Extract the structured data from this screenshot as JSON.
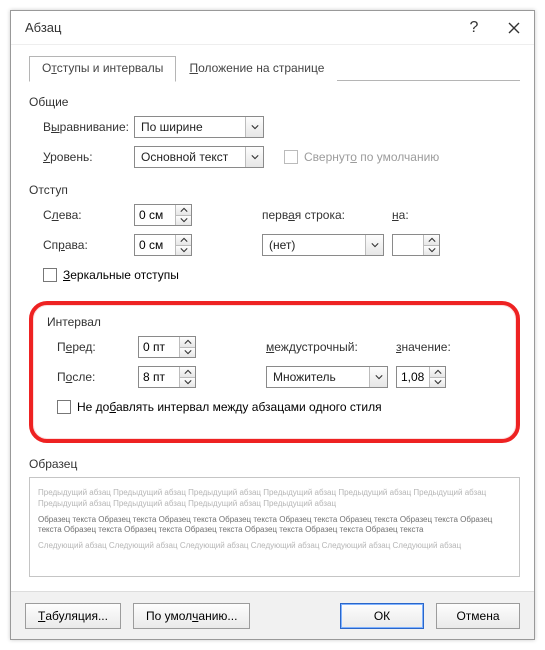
{
  "title": "Абзац",
  "tabs": {
    "indents": {
      "pre": "О",
      "u": "т",
      "post": "ступы и интервалы"
    },
    "position": {
      "pre": "",
      "u": "П",
      "post": "оложение на странице"
    }
  },
  "groups": {
    "general": {
      "title": "Общие",
      "alignment": {
        "label": "Выравнивание:",
        "u": "ы",
        "pre": "В",
        "post": "равнивание:",
        "value": "По ширине"
      },
      "level": {
        "pre": "",
        "u": "У",
        "post": "ровень:",
        "value": "Основной текст"
      },
      "collapse": {
        "pre": "Свернут",
        "u": "о",
        "post": " по умолчанию"
      }
    },
    "indent": {
      "title": "Отступ",
      "left": {
        "pre": "С",
        "u": "л",
        "post": "ева:",
        "value": "0 см"
      },
      "right": {
        "pre": "Сп",
        "u": "р",
        "post": "ава:",
        "value": "0 см"
      },
      "first_line_label": {
        "pre": "перв",
        "u": "а",
        "post": "я строка:"
      },
      "first_line_value": "(нет)",
      "by_label": {
        "pre": "",
        "u": "н",
        "post": "а:"
      },
      "by_value": "",
      "mirror": {
        "pre": "",
        "u": "З",
        "post": "еркальные отступы"
      }
    },
    "spacing": {
      "title": "Интервал",
      "before": {
        "pre": "П",
        "u": "е",
        "post": "ред:",
        "value": "0 пт"
      },
      "after": {
        "pre": "П",
        "u": "о",
        "post": "сле:",
        "value": "8 пт"
      },
      "line_spacing_label": {
        "pre": "",
        "u": "м",
        "post": "еждустрочный:"
      },
      "line_spacing_value": "Множитель",
      "at_label": {
        "pre": "",
        "u": "з",
        "post": "начение:"
      },
      "at_value": "1,08",
      "no_space": {
        "pre": "Не до",
        "u": "б",
        "post": "авлять интервал между абзацами одного стиля"
      }
    },
    "sample": {
      "title": "Образец",
      "prev": "Предыдущий абзац Предыдущий абзац Предыдущий абзац Предыдущий абзац Предыдущий абзац Предыдущий абзац Предыдущий абзац Предыдущий абзац Предыдущий абзац Предыдущий абзац",
      "mid": "Образец текста Образец текста Образец текста Образец текста Образец текста Образец текста Образец текста Образец текста Образец текста Образец текста Образец текста Образец текста Образец текста Образец текста",
      "next": "Следующий абзац Следующий абзац Следующий абзац Следующий абзац Следующий абзац Следующий абзац"
    }
  },
  "footer": {
    "tabs": {
      "pre": "",
      "u": "Т",
      "post": "абуляция..."
    },
    "default": {
      "pre": "По умол",
      "u": "ч",
      "post": "анию..."
    },
    "ok": "ОК",
    "cancel": "Отмена"
  }
}
